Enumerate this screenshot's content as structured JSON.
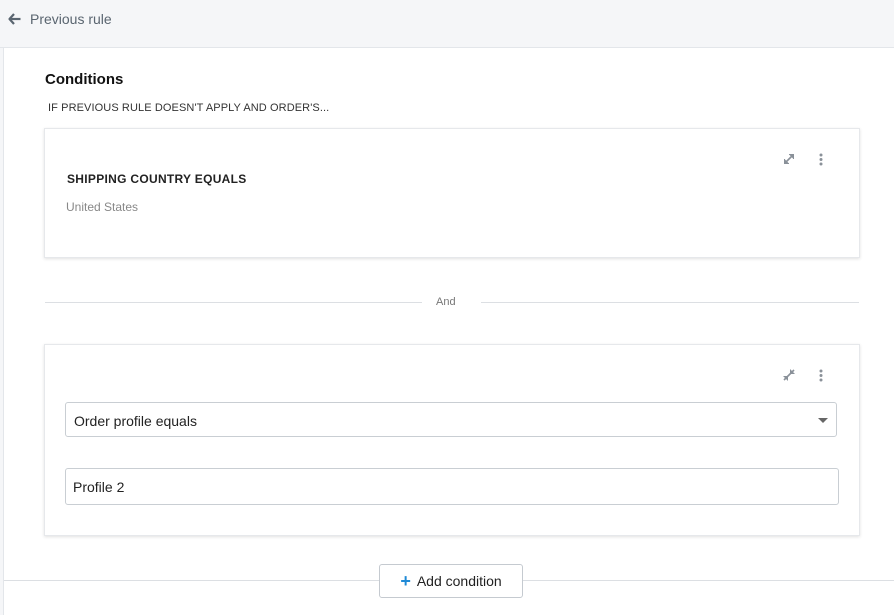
{
  "nav": {
    "back_label": "Previous rule"
  },
  "conditions": {
    "title": "Conditions",
    "subtitle": "IF PREVIOUS RULE DOESN'T APPLY AND ORDER'S...",
    "collapsed_condition": {
      "title": "SHIPPING COUNTRY EQUALS",
      "value": "United States"
    },
    "connector": "And",
    "expanded_condition": {
      "selected_type": "Order profile equals",
      "value": "Profile 2"
    },
    "add_button_label": "Add condition"
  },
  "colors": {
    "accent": "#1f8ad6",
    "background": "#f5f6f8",
    "panel": "#ffffff",
    "muted_text": "#888888"
  }
}
